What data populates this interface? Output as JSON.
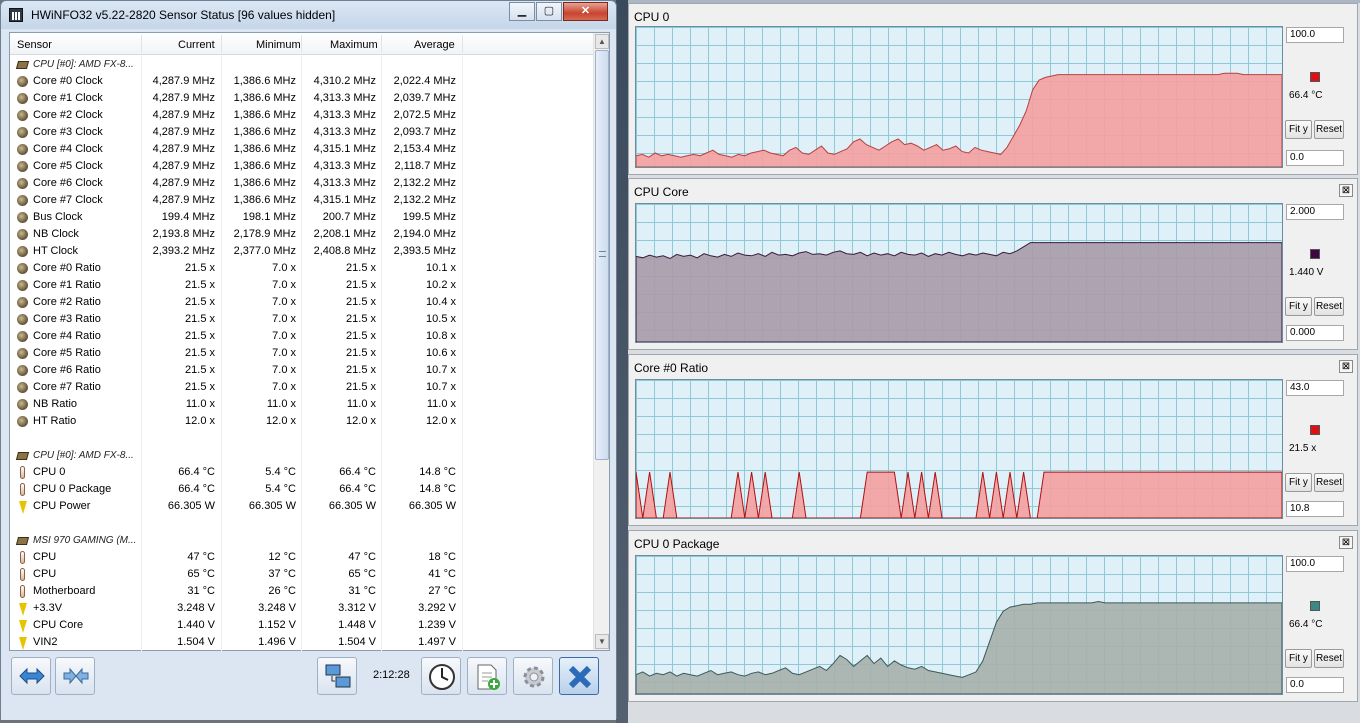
{
  "window": {
    "title": "HWiNFO32 v5.22-2820 Sensor Status [96 values hidden]"
  },
  "columns": [
    "Sensor",
    "Current",
    "Minimum",
    "Maximum",
    "Average"
  ],
  "rows": [
    {
      "type": "group",
      "icon": "chip-icon",
      "label": "CPU [#0]: AMD FX-8...",
      "v": [
        "",
        "",
        "",
        ""
      ]
    },
    {
      "type": "item",
      "icon": "clock-icon",
      "label": "Core #0 Clock",
      "v": [
        "4,287.9 MHz",
        "1,386.6 MHz",
        "4,310.2 MHz",
        "2,022.4 MHz"
      ]
    },
    {
      "type": "item",
      "icon": "clock-icon",
      "label": "Core #1 Clock",
      "v": [
        "4,287.9 MHz",
        "1,386.6 MHz",
        "4,313.3 MHz",
        "2,039.7 MHz"
      ]
    },
    {
      "type": "item",
      "icon": "clock-icon",
      "label": "Core #2 Clock",
      "v": [
        "4,287.9 MHz",
        "1,386.6 MHz",
        "4,313.3 MHz",
        "2,072.5 MHz"
      ]
    },
    {
      "type": "item",
      "icon": "clock-icon",
      "label": "Core #3 Clock",
      "v": [
        "4,287.9 MHz",
        "1,386.6 MHz",
        "4,313.3 MHz",
        "2,093.7 MHz"
      ]
    },
    {
      "type": "item",
      "icon": "clock-icon",
      "label": "Core #4 Clock",
      "v": [
        "4,287.9 MHz",
        "1,386.6 MHz",
        "4,315.1 MHz",
        "2,153.4 MHz"
      ]
    },
    {
      "type": "item",
      "icon": "clock-icon",
      "label": "Core #5 Clock",
      "v": [
        "4,287.9 MHz",
        "1,386.6 MHz",
        "4,313.3 MHz",
        "2,118.7 MHz"
      ]
    },
    {
      "type": "item",
      "icon": "clock-icon",
      "label": "Core #6 Clock",
      "v": [
        "4,287.9 MHz",
        "1,386.6 MHz",
        "4,313.3 MHz",
        "2,132.2 MHz"
      ]
    },
    {
      "type": "item",
      "icon": "clock-icon",
      "label": "Core #7 Clock",
      "v": [
        "4,287.9 MHz",
        "1,386.6 MHz",
        "4,315.1 MHz",
        "2,132.2 MHz"
      ]
    },
    {
      "type": "item",
      "icon": "clock-icon",
      "label": "Bus Clock",
      "v": [
        "199.4 MHz",
        "198.1 MHz",
        "200.7 MHz",
        "199.5 MHz"
      ]
    },
    {
      "type": "item",
      "icon": "clock-icon",
      "label": "NB Clock",
      "v": [
        "2,193.8 MHz",
        "2,178.9 MHz",
        "2,208.1 MHz",
        "2,194.0 MHz"
      ]
    },
    {
      "type": "item",
      "icon": "clock-icon",
      "label": "HT Clock",
      "v": [
        "2,393.2 MHz",
        "2,377.0 MHz",
        "2,408.8 MHz",
        "2,393.5 MHz"
      ]
    },
    {
      "type": "item",
      "icon": "clock-icon",
      "label": "Core #0 Ratio",
      "v": [
        "21.5 x",
        "7.0 x",
        "21.5 x",
        "10.1 x"
      ]
    },
    {
      "type": "item",
      "icon": "clock-icon",
      "label": "Core #1 Ratio",
      "v": [
        "21.5 x",
        "7.0 x",
        "21.5 x",
        "10.2 x"
      ]
    },
    {
      "type": "item",
      "icon": "clock-icon",
      "label": "Core #2 Ratio",
      "v": [
        "21.5 x",
        "7.0 x",
        "21.5 x",
        "10.4 x"
      ]
    },
    {
      "type": "item",
      "icon": "clock-icon",
      "label": "Core #3 Ratio",
      "v": [
        "21.5 x",
        "7.0 x",
        "21.5 x",
        "10.5 x"
      ]
    },
    {
      "type": "item",
      "icon": "clock-icon",
      "label": "Core #4 Ratio",
      "v": [
        "21.5 x",
        "7.0 x",
        "21.5 x",
        "10.8 x"
      ]
    },
    {
      "type": "item",
      "icon": "clock-icon",
      "label": "Core #5 Ratio",
      "v": [
        "21.5 x",
        "7.0 x",
        "21.5 x",
        "10.6 x"
      ]
    },
    {
      "type": "item",
      "icon": "clock-icon",
      "label": "Core #6 Ratio",
      "v": [
        "21.5 x",
        "7.0 x",
        "21.5 x",
        "10.7 x"
      ]
    },
    {
      "type": "item",
      "icon": "clock-icon",
      "label": "Core #7 Ratio",
      "v": [
        "21.5 x",
        "7.0 x",
        "21.5 x",
        "10.7 x"
      ]
    },
    {
      "type": "item",
      "icon": "clock-icon",
      "label": "NB Ratio",
      "v": [
        "11.0 x",
        "11.0 x",
        "11.0 x",
        "11.0 x"
      ]
    },
    {
      "type": "item",
      "icon": "clock-icon",
      "label": "HT Ratio",
      "v": [
        "12.0 x",
        "12.0 x",
        "12.0 x",
        "12.0 x"
      ]
    },
    {
      "type": "blank",
      "icon": "",
      "label": "",
      "v": [
        "",
        "",
        "",
        ""
      ]
    },
    {
      "type": "group",
      "icon": "chip-icon",
      "label": "CPU [#0]: AMD FX-8...",
      "v": [
        "",
        "",
        "",
        ""
      ]
    },
    {
      "type": "item",
      "icon": "thermometer-icon",
      "label": "CPU 0",
      "v": [
        "66.4 °C",
        "5.4 °C",
        "66.4 °C",
        "14.8 °C"
      ]
    },
    {
      "type": "item",
      "icon": "thermometer-icon",
      "label": "CPU 0 Package",
      "v": [
        "66.4 °C",
        "5.4 °C",
        "66.4 °C",
        "14.8 °C"
      ]
    },
    {
      "type": "item",
      "icon": "bolt-icon",
      "label": "CPU Power",
      "v": [
        "66.305 W",
        "66.305 W",
        "66.305 W",
        "66.305 W"
      ]
    },
    {
      "type": "blank",
      "icon": "",
      "label": "",
      "v": [
        "",
        "",
        "",
        ""
      ]
    },
    {
      "type": "group",
      "icon": "chip-icon",
      "label": "MSI 970 GAMING (M...",
      "v": [
        "",
        "",
        "",
        ""
      ]
    },
    {
      "type": "item",
      "icon": "thermometer-icon",
      "label": "CPU",
      "v": [
        "47 °C",
        "12 °C",
        "47 °C",
        "18 °C"
      ]
    },
    {
      "type": "item",
      "icon": "thermometer-icon",
      "label": "CPU",
      "v": [
        "65 °C",
        "37 °C",
        "65 °C",
        "41 °C"
      ]
    },
    {
      "type": "item",
      "icon": "thermometer-icon",
      "label": "Motherboard",
      "v": [
        "31 °C",
        "26 °C",
        "31 °C",
        "27 °C"
      ]
    },
    {
      "type": "item",
      "icon": "bolt-icon",
      "label": "+3.3V",
      "v": [
        "3.248 V",
        "3.248 V",
        "3.312 V",
        "3.292 V"
      ]
    },
    {
      "type": "item",
      "icon": "bolt-icon",
      "label": "CPU Core",
      "v": [
        "1.440 V",
        "1.152 V",
        "1.448 V",
        "1.239 V"
      ]
    },
    {
      "type": "item",
      "icon": "bolt-icon",
      "label": "VIN2",
      "v": [
        "1.504 V",
        "1.496 V",
        "1.504 V",
        "1.497 V"
      ]
    }
  ],
  "toolbar": {
    "timer": "2:12:28"
  },
  "graphs": [
    {
      "title": "CPU 0",
      "max": "100.0",
      "current": "66.4 °C",
      "min": "0.0",
      "color": "#f4a0a0",
      "stroke": "#b84040",
      "swatch": "#dd1111",
      "fit": "Fit y",
      "reset": "Reset",
      "close": "⊠",
      "chart_data": {
        "type": "area",
        "ylim": [
          0,
          100
        ],
        "values": [
          8,
          9,
          7,
          10,
          8,
          9,
          8,
          7,
          8,
          9,
          8,
          10,
          12,
          9,
          8,
          7,
          9,
          8,
          10,
          11,
          12,
          10,
          9,
          8,
          12,
          14,
          10,
          9,
          12,
          15,
          10,
          9,
          11,
          13,
          18,
          20,
          16,
          14,
          12,
          15,
          18,
          20,
          16,
          17,
          15,
          12,
          14,
          16,
          12,
          13,
          15,
          11,
          10,
          14,
          12,
          11,
          10,
          9,
          14,
          22,
          30,
          40,
          55,
          62,
          64,
          65,
          66,
          66,
          66,
          66,
          66,
          66,
          66,
          66,
          66,
          66,
          66,
          66,
          66,
          66,
          66,
          66,
          66,
          66,
          66,
          66,
          66,
          66,
          66,
          66,
          66,
          66,
          67,
          67,
          67,
          66,
          66,
          66,
          66,
          66,
          66,
          66
        ]
      }
    },
    {
      "title": "CPU Core",
      "max": "2.000",
      "current": "1.440 V",
      "min": "0.000",
      "color": "#a89ba8",
      "stroke": "#3a1a3a",
      "swatch": "#400840",
      "fit": "Fit y",
      "reset": "Reset",
      "close": "⊠",
      "chart_data": {
        "type": "area",
        "ylim": [
          0,
          2
        ],
        "values": [
          1.24,
          1.22,
          1.26,
          1.23,
          1.25,
          1.21,
          1.27,
          1.24,
          1.26,
          1.22,
          1.28,
          1.25,
          1.23,
          1.27,
          1.24,
          1.29,
          1.26,
          1.25,
          1.28,
          1.24,
          1.3,
          1.26,
          1.27,
          1.25,
          1.29,
          1.31,
          1.27,
          1.28,
          1.26,
          1.3,
          1.32,
          1.28,
          1.27,
          1.3,
          1.25,
          1.29,
          1.26,
          1.28,
          1.25,
          1.3,
          1.27,
          1.26,
          1.29,
          1.24,
          1.28,
          1.26,
          1.3,
          1.27,
          1.25,
          1.28,
          1.26,
          1.29,
          1.27,
          1.25,
          1.3,
          1.28,
          1.32,
          1.38,
          1.44,
          1.44,
          1.44,
          1.44,
          1.44,
          1.44,
          1.44,
          1.44,
          1.44,
          1.44,
          1.44,
          1.44,
          1.44,
          1.44,
          1.44,
          1.44,
          1.44,
          1.44,
          1.44,
          1.44,
          1.44,
          1.44,
          1.44,
          1.44,
          1.44,
          1.44,
          1.44,
          1.44,
          1.44,
          1.44,
          1.44,
          1.44,
          1.44,
          1.44,
          1.44,
          1.44,
          1.44,
          1.44
        ]
      }
    },
    {
      "title": "Core #0 Ratio",
      "max": "43.0",
      "current": "21.5 x",
      "min": "10.8",
      "color": "#f4a0a0",
      "stroke": "#b01010",
      "swatch": "#dd1111",
      "fit": "Fit y",
      "reset": "Reset",
      "close": "⊠",
      "chart_data": {
        "type": "area",
        "ylim": [
          10.8,
          43
        ],
        "values": [
          21.5,
          10.8,
          21.5,
          10.8,
          10.8,
          21.5,
          10.8,
          10.8,
          10.8,
          10.8,
          10.8,
          10.8,
          10.8,
          10.8,
          10.8,
          21.5,
          10.8,
          21.5,
          10.8,
          21.5,
          10.8,
          10.8,
          10.8,
          10.8,
          21.5,
          10.8,
          10.8,
          10.8,
          10.8,
          10.8,
          10.8,
          10.8,
          10.8,
          10.8,
          21.5,
          21.5,
          21.5,
          21.5,
          21.5,
          10.8,
          21.5,
          10.8,
          21.5,
          10.8,
          21.5,
          10.8,
          10.8,
          10.8,
          10.8,
          10.8,
          10.8,
          21.5,
          10.8,
          21.5,
          10.8,
          21.5,
          10.8,
          21.5,
          10.8,
          10.8,
          21.5,
          21.5,
          21.5,
          21.5,
          21.5,
          21.5,
          21.5,
          21.5,
          21.5,
          21.5,
          21.5,
          21.5,
          21.5,
          21.5,
          21.5,
          21.5,
          21.5,
          21.5,
          21.5,
          21.5,
          21.5,
          21.5,
          21.5,
          21.5,
          21.5,
          21.5,
          21.5,
          21.5,
          21.5,
          21.5,
          21.5,
          21.5,
          21.5,
          21.5,
          21.5,
          21.5
        ]
      }
    },
    {
      "title": "CPU 0 Package",
      "max": "100.0",
      "current": "66.4 °C",
      "min": "0.0",
      "color": "#a6b0ac",
      "stroke": "#3a5a58",
      "swatch": "#3a8a84",
      "fit": "Fit y",
      "reset": "Reset",
      "close": "⊠",
      "chart_data": {
        "type": "area",
        "ylim": [
          0,
          100
        ],
        "values": [
          14,
          16,
          13,
          15,
          14,
          16,
          13,
          15,
          14,
          13,
          15,
          17,
          14,
          15,
          16,
          14,
          13,
          15,
          16,
          14,
          15,
          17,
          19,
          15,
          14,
          16,
          18,
          20,
          17,
          22,
          28,
          25,
          20,
          24,
          28,
          22,
          26,
          20,
          24,
          21,
          19,
          18,
          20,
          17,
          16,
          15,
          14,
          13,
          12,
          14,
          16,
          24,
          38,
          52,
          60,
          63,
          64,
          65,
          65,
          66,
          66,
          66,
          66,
          66,
          66,
          66,
          66,
          66,
          67,
          66,
          66,
          66,
          66,
          66,
          66,
          66,
          66,
          66,
          66,
          66,
          66,
          66,
          66,
          66,
          66,
          66,
          66,
          66,
          66,
          66,
          66,
          66,
          66,
          66,
          66,
          66
        ]
      }
    }
  ]
}
